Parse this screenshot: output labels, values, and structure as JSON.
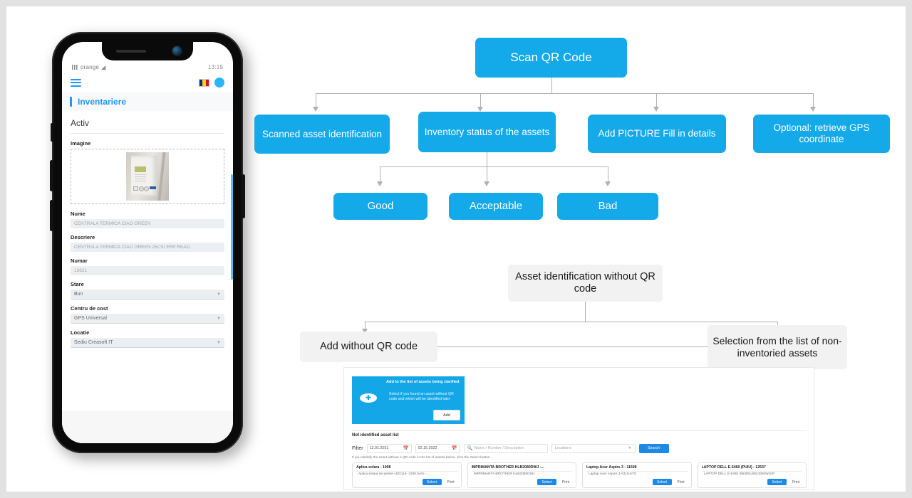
{
  "phone": {
    "status_bar": {
      "carrier": "orange",
      "wifi_icon": "wifi-icon",
      "time": "13:19"
    },
    "nav": {
      "menu_icon": "hamburger-menu-icon",
      "flag_icon": "romania-flag-icon",
      "avatar_icon": "user-avatar-icon"
    },
    "page_title": "Inventariere",
    "section_title": "Activ",
    "fields": [
      {
        "label": "Imagine",
        "type": "image",
        "value": "asset-photo-boiler"
      },
      {
        "label": "Nume",
        "type": "text",
        "value": "CENTRALA TERMICA CIAO GREEN"
      },
      {
        "label": "Descriere",
        "type": "text",
        "value": "CENTRALA TERMICA CIAO GREEN 25CSI ERP READ"
      },
      {
        "label": "Numar",
        "type": "text",
        "value": "13621"
      },
      {
        "label": "Stare",
        "type": "select",
        "value": "Bun"
      },
      {
        "label": "Centru de cost",
        "type": "select",
        "value": "GPS Universal"
      },
      {
        "label": "Locatie",
        "type": "select",
        "value": "Sediu Creasoft IT"
      }
    ]
  },
  "colors": {
    "accent_blue": "#14a9e8",
    "node_grey": "#f2f2f2",
    "line_grey": "#b0b0b0",
    "button_blue": "#1e88e5"
  },
  "flow_top": {
    "root": "Scan QR Code",
    "children": [
      "Scanned asset identification",
      "Inventory status of the assets",
      "Add PICTURE Fill in details",
      "Optional: retrieve GPS coordinate"
    ],
    "statuses": [
      "Good",
      "Acceptable",
      "Bad"
    ]
  },
  "flow_bottom": {
    "root": "Asset identification without QR code",
    "left": "Add without QR code",
    "right": "Selection from the list of non-inventoried assets"
  },
  "screenshot": {
    "add_card": {
      "title": "Add to the list of assets being clarified",
      "subtitle": "Select if you found an asset without QR code and which will be identified later",
      "plus_icon": "plus-icon",
      "button": "Add"
    },
    "list_heading": "Not identified asset list",
    "filter": {
      "label": "Filter",
      "date_from": "12.01.2021",
      "date_to": "02.15.2022",
      "calendar_icon": "calendar-icon",
      "search_icon": "search-icon",
      "text_placeholder": "Name / Number / Description",
      "location_placeholder": "Locations",
      "search_button": "Search"
    },
    "hint": "If you identify the asset without a QR code in the list of assets below, click the Select button",
    "actions": {
      "select": "Select",
      "print": "Print"
    },
    "assets": [
      {
        "title": "Aplica solara - 1008",
        "desc": "Aplica solara de perete LED118- 2200 mAh- ..."
      },
      {
        "title": "IMPRIMANTA BROTHER HLB2080DWJ -...",
        "desc": "IMPRIMANTA BROTHER HLB2080DWJ"
      },
      {
        "title": "Laptop Acer Aspire 3 - 11508",
        "desc": "Laptop Acer Aspire 3 A315-57G"
      },
      {
        "title": "LAPTOP DELL E-5460 (PUIU) - 12537",
        "desc": "LAPTOP DELL E-5460 I56300U/8G/256/W10P"
      }
    ]
  }
}
